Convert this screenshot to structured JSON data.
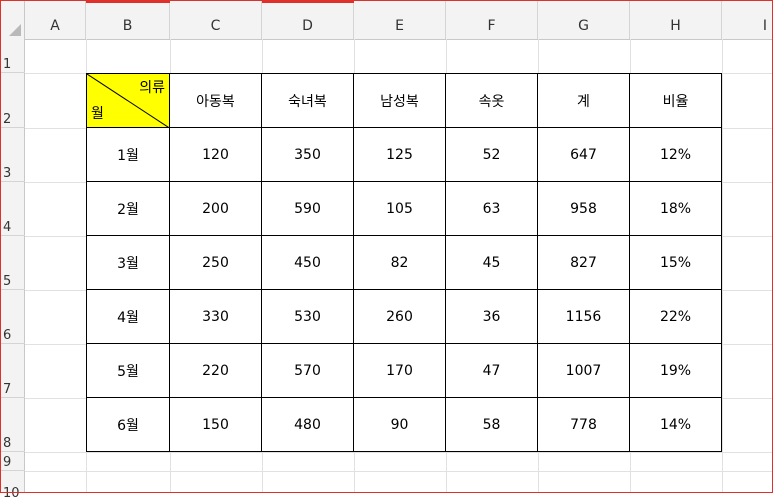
{
  "columns": [
    "A",
    "B",
    "C",
    "D",
    "E",
    "F",
    "G",
    "H",
    "I"
  ],
  "rows": [
    "1",
    "2",
    "3",
    "4",
    "5",
    "6",
    "7",
    "8",
    "9",
    "10"
  ],
  "table": {
    "corner_top": "의류",
    "corner_bottom": "월",
    "headers": [
      "아동복",
      "숙녀복",
      "남성복",
      "속옷",
      "계",
      "비율"
    ],
    "data": [
      [
        "1월",
        "120",
        "350",
        "125",
        "52",
        "647",
        "12%"
      ],
      [
        "2월",
        "200",
        "590",
        "105",
        "63",
        "958",
        "18%"
      ],
      [
        "3월",
        "250",
        "450",
        "82",
        "45",
        "827",
        "15%"
      ],
      [
        "4월",
        "330",
        "530",
        "260",
        "36",
        "1156",
        "22%"
      ],
      [
        "5월",
        "220",
        "570",
        "170",
        "47",
        "1007",
        "19%"
      ],
      [
        "6월",
        "150",
        "480",
        "90",
        "58",
        "778",
        "14%"
      ]
    ]
  },
  "colors": {
    "corner_fill": "#ffff00",
    "frame": "#e0302c"
  }
}
